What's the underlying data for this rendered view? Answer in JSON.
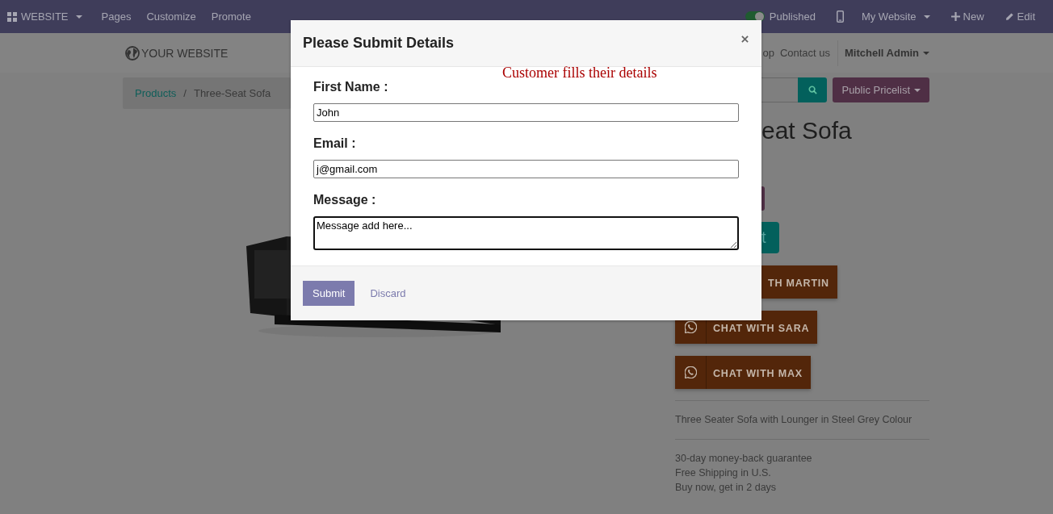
{
  "topbar": {
    "app_menu": "WEBSITE",
    "menu": [
      "Pages",
      "Customize",
      "Promote"
    ],
    "published": {
      "label": "Published",
      "on": true
    },
    "website_menu": "My Website",
    "new": "New",
    "edit": "Edit"
  },
  "header": {
    "logo": "YOUR WEBSITE",
    "nav": [
      "op",
      "Contact us"
    ],
    "user": "Mitchell Admin"
  },
  "breadcrumb": {
    "separator": "/",
    "items": [
      {
        "label": "Products",
        "kind": "link"
      },
      {
        "label": "Three-Seat Sofa",
        "kind": "current"
      }
    ]
  },
  "pricelist": "Public Pricelist",
  "product": {
    "title": "eat Sofa",
    "buttons": [
      {
        "kind": "variant"
      },
      {
        "kind": "cart",
        "label": "t"
      }
    ],
    "chat_buttons": [
      {
        "label": "TH MARTIN",
        "icon": false
      },
      {
        "label": "CHAT WITH SARA",
        "icon": true
      },
      {
        "label": "CHAT WITH MAX",
        "icon": true
      }
    ],
    "description": "Three Seater Sofa with Lounger in Steel Grey Colour",
    "notes": [
      "30-day money-back guarantee",
      "Free Shipping in U.S.",
      "Buy now, get in 2 days"
    ]
  },
  "annotation": "Customer fills their details",
  "dialog": {
    "title": "Please Submit Details",
    "fields": [
      {
        "label": "First Name :",
        "value": "John",
        "kind": "input",
        "focused": false
      },
      {
        "label": "Email :",
        "value": "j@gmail.com",
        "kind": "input",
        "focused": false
      },
      {
        "label": "Message :",
        "value": "Message add here...",
        "kind": "textarea",
        "focused": true
      }
    ],
    "buttons": [
      {
        "label": "Submit",
        "kind": "primary"
      },
      {
        "label": "Discard",
        "kind": "link"
      }
    ]
  }
}
